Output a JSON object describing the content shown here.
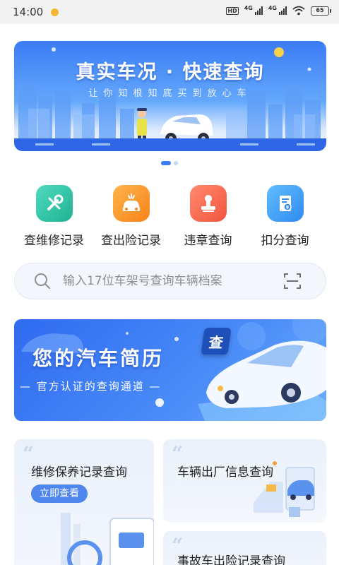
{
  "status_bar": {
    "time": "14:00",
    "hd_label": "HD",
    "network_1": "4G",
    "network_2": "4G",
    "battery": "65"
  },
  "banner": {
    "title": "真实车况 · 快速查询",
    "subtitle": "让你知根知底买到放心车",
    "active_slide": 1,
    "slide_count": 2
  },
  "quick_menu": [
    {
      "label": "查维修记录",
      "icon": "wrench-screwdriver-icon",
      "color": "#2dc6a6"
    },
    {
      "label": "查出险记录",
      "icon": "car-crash-icon",
      "color": "#fb9b2e"
    },
    {
      "label": "违章查询",
      "icon": "stamp-icon",
      "color": "#f5664f"
    },
    {
      "label": "扣分查询",
      "icon": "document-badge-icon",
      "color": "#3fa3f6"
    }
  ],
  "search": {
    "placeholder": "输入17位车架号查询车辆档案"
  },
  "promo": {
    "title": "您的汽车简历",
    "subtitle": "— 官方认证的查询通道 —",
    "tag": "查"
  },
  "cards": {
    "big": {
      "title": "维修保养记录查询",
      "button": "立即查看"
    },
    "a": {
      "title": "车辆出厂信息查询"
    },
    "b": {
      "title": "事故车出险记录查询"
    }
  },
  "colors": {
    "accent": "#3b7cf6",
    "button": "#4f86ee"
  }
}
